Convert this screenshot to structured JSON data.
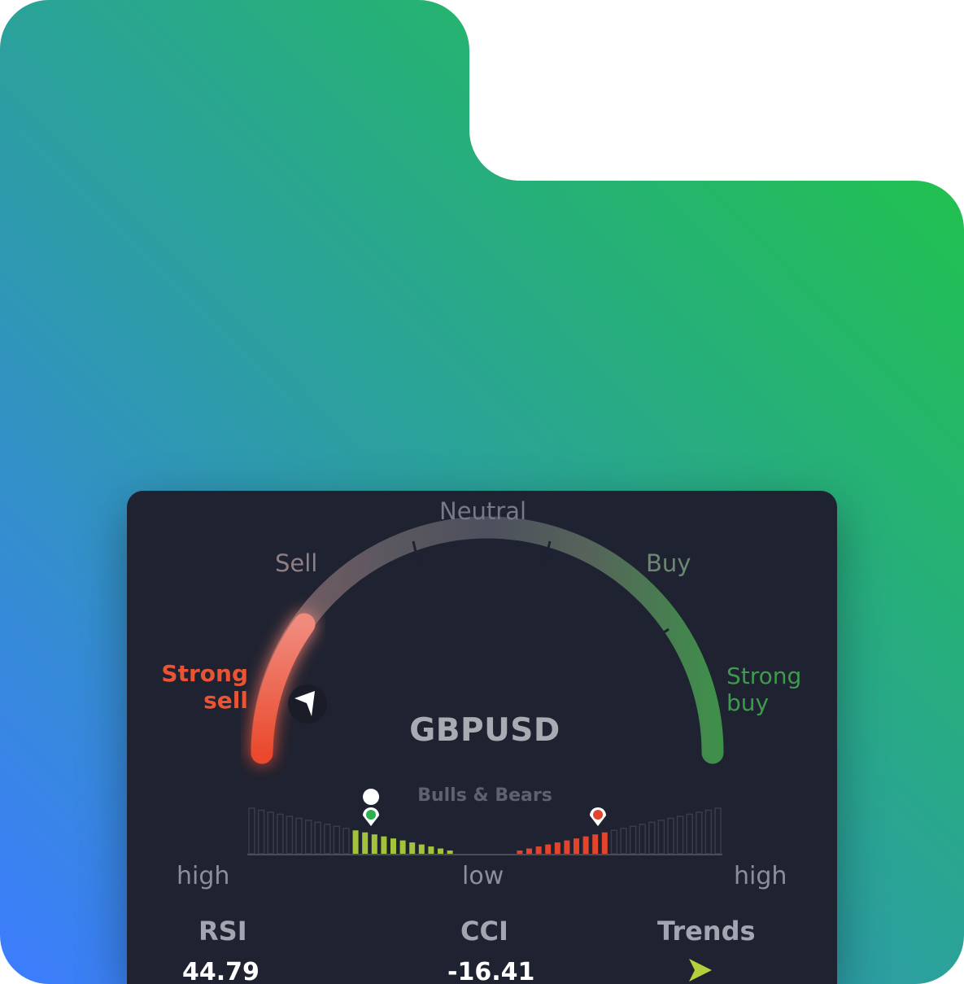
{
  "gauge": {
    "labels": {
      "neutral": "Neutral",
      "sell": "Sell",
      "buy": "Buy",
      "strong_sell_line1": "Strong",
      "strong_sell_line2": "sell",
      "strong_buy_line1": "Strong",
      "strong_buy_line2": "buy"
    },
    "symbol": "GBPUSD",
    "signal": "Strong sell",
    "colors": {
      "strong_sell": "#ea5334",
      "strong_buy": "#3f9a4e",
      "neutral": "#4b4e5c"
    }
  },
  "bulls_bears": {
    "title": "Bulls & Bears",
    "scale": {
      "left": "high",
      "middle": "low",
      "right": "high"
    },
    "bulls_level": 0.5,
    "bears_level": 0.47,
    "colors": {
      "bulls": "#a4c33a",
      "bears": "#e2452b",
      "inactive": "#3a3d48"
    }
  },
  "metrics": {
    "rsi": {
      "label": "RSI",
      "value": "44.79"
    },
    "cci": {
      "label": "CCI",
      "value": "-16.41"
    },
    "trends": {
      "label": "Trends",
      "icon": "trend-arrow-icon"
    }
  }
}
